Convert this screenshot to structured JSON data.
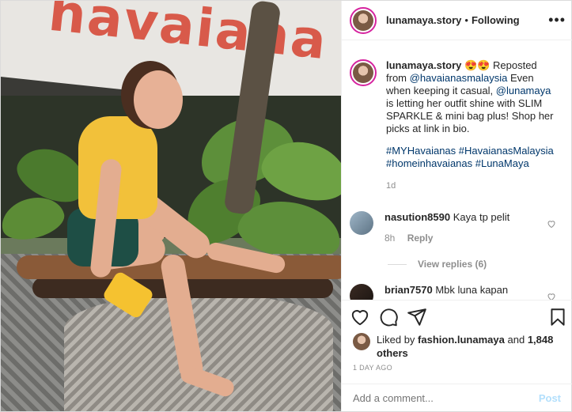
{
  "header": {
    "username": "lunamaya.story",
    "separator": "•",
    "follow_status": "Following",
    "more_label": "•••"
  },
  "photo": {
    "sign_text": "havaiana"
  },
  "caption": {
    "username": "lunamaya.story",
    "emojis": "😍😍",
    "text_1": "Reposted from",
    "mention_1": "@havaianasmalaysia",
    "text_2": "Even when keeping it casual,",
    "mention_2": "@lunamaya",
    "text_3": "is letting her outfit shine with SLIM SPARKLE & mini bag plus! Shop her picks at link in bio.",
    "hashtags": "#MYHavaianas #HavaianasMalaysia #homeinhavaianas #LunaMaya",
    "time": "1d"
  },
  "comments": [
    {
      "username": "nasution8590",
      "text": "Kaya tp pelit",
      "time": "8h",
      "reply_label": "Reply",
      "view_replies": "View replies (6)"
    },
    {
      "username": "brian7570",
      "text": "Mbk luna kapan"
    }
  ],
  "likes": {
    "prefix": "Liked by",
    "user": "fashion.lunamaya",
    "and": "and",
    "others": "1,848 others"
  },
  "date": "1 DAY AGO",
  "add_comment": {
    "placeholder": "Add a comment...",
    "post_label": "Post"
  },
  "colors": {
    "link": "#00376b",
    "muted": "#8e8e8e",
    "post_disabled": "#b2dffc",
    "story_ring": "#d6249f"
  },
  "icons": {
    "like": "heart-icon",
    "comment": "comment-icon",
    "share": "share-icon",
    "save": "bookmark-icon",
    "more": "more-options-icon"
  }
}
